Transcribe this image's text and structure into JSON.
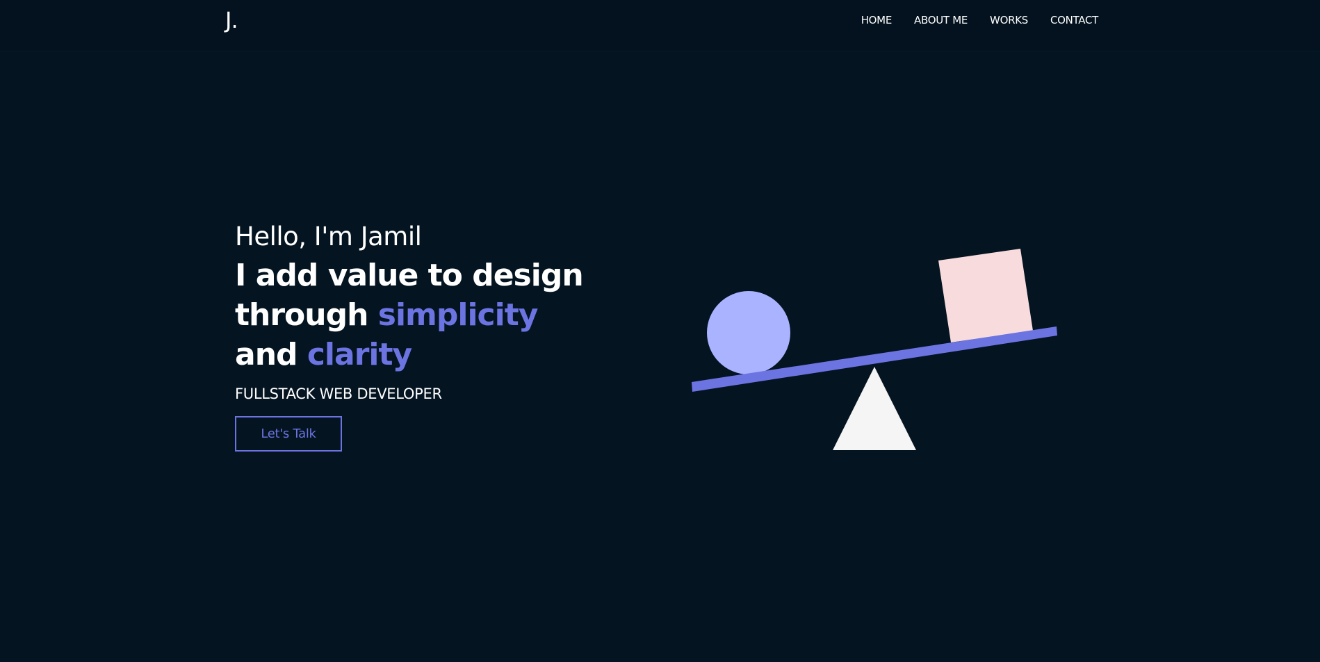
{
  "header": {
    "logo": "J.",
    "nav": [
      {
        "label": "HOME"
      },
      {
        "label": "ABOUT ME"
      },
      {
        "label": "WORKS"
      },
      {
        "label": "CONTACT"
      }
    ]
  },
  "hero": {
    "greeting": "Hello, I'm Jamil",
    "headline": {
      "line1": "I add value to design",
      "line2_plain": "through ",
      "line2_accent": "simplicity",
      "line3_plain": "and ",
      "line3_accent": "clarity"
    },
    "role": "FULLSTACK WEB DEVELOPER",
    "cta_label": "Let's Talk"
  },
  "colors": {
    "background": "#041421",
    "accent": "#6c74e2",
    "circle": "#aab3ff",
    "square": "#f8dcdd",
    "triangle": "#f5f5f5"
  },
  "icons": {
    "illustration": "seesaw-illustration"
  }
}
